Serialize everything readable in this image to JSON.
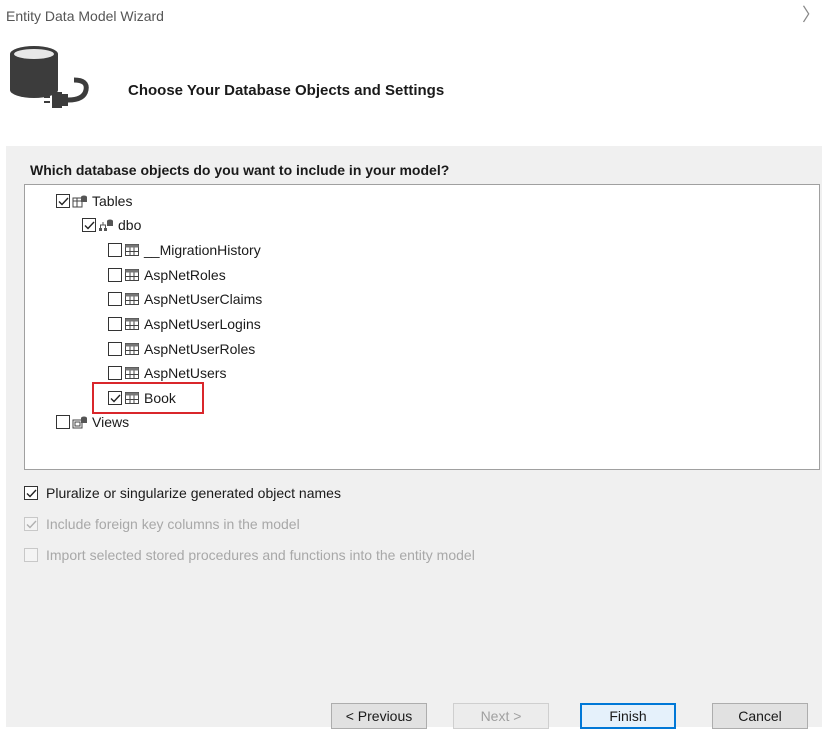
{
  "window": {
    "title": "Entity Data Model Wizard",
    "close_glyph": "〉"
  },
  "header": {
    "heading": "Choose Your Database Objects and Settings",
    "icon": "database-connect-icon"
  },
  "tree": {
    "question": "Which database objects do you want to include in your model?",
    "tables": {
      "label": "Tables",
      "checked": true,
      "dbo": {
        "label": "dbo",
        "checked": true,
        "items": [
          {
            "label": "__MigrationHistory",
            "checked": false
          },
          {
            "label": "AspNetRoles",
            "checked": false
          },
          {
            "label": "AspNetUserClaims",
            "checked": false
          },
          {
            "label": "AspNetUserLogins",
            "checked": false
          },
          {
            "label": "AspNetUserRoles",
            "checked": false
          },
          {
            "label": "AspNetUsers",
            "checked": false
          },
          {
            "label": "Book",
            "checked": true
          }
        ]
      }
    },
    "views": {
      "label": "Views",
      "checked": false
    }
  },
  "options": {
    "pluralize": {
      "label": "Pluralize or singularize generated object names",
      "checked": true,
      "enabled": true
    },
    "foreign_keys": {
      "label": "Include foreign key columns in the model",
      "checked": true,
      "enabled": false
    },
    "stored_procs": {
      "label": "Import selected stored procedures and functions into the entity model",
      "checked": false,
      "enabled": false
    }
  },
  "buttons": {
    "previous": "< Previous",
    "next": "Next >",
    "finish": "Finish",
    "cancel": "Cancel"
  },
  "colors": {
    "accent": "#0078d7",
    "highlight": "#d9262b",
    "panel": "#f0f0f0"
  }
}
